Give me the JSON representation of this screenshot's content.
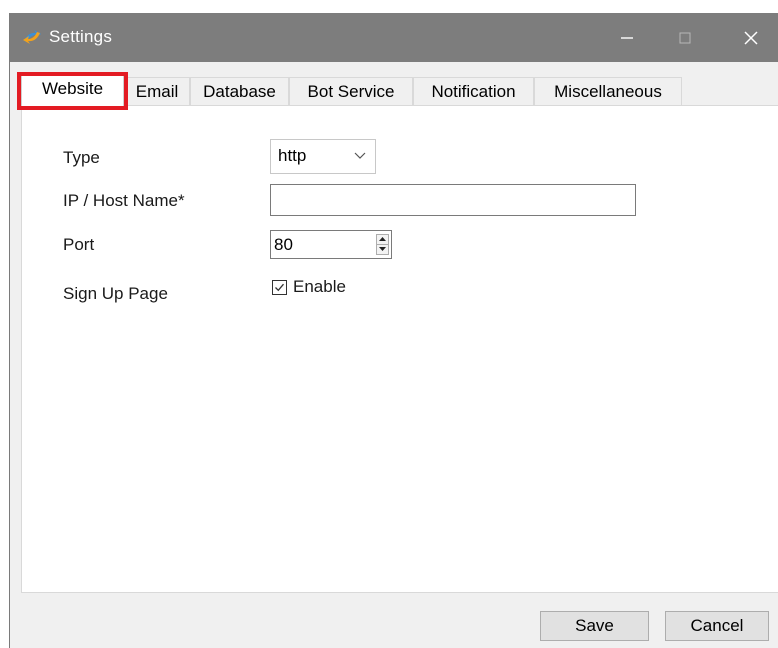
{
  "window": {
    "title": "Settings",
    "app_icon": "settings-app-icon",
    "controls": [
      "minimize-icon",
      "maximize-icon",
      "close-icon"
    ]
  },
  "tabs": [
    {
      "label": "Website",
      "active": true
    },
    {
      "label": "Email",
      "active": false
    },
    {
      "label": "Database",
      "active": false
    },
    {
      "label": "Bot Service",
      "active": false
    },
    {
      "label": "Notification",
      "active": false
    },
    {
      "label": "Miscellaneous",
      "active": false
    }
  ],
  "form": {
    "type_label": "Type",
    "type_value": "http",
    "host_label": "IP / Host Name*",
    "host_value": "",
    "port_label": "Port",
    "port_value": "80",
    "signup_label": "Sign Up Page",
    "signup_checkbox_label": "Enable",
    "signup_checked": true
  },
  "buttons": {
    "save": "Save",
    "cancel": "Cancel"
  },
  "colors": {
    "titlebar": "#7d7d7d",
    "highlight": "#e31b23"
  }
}
